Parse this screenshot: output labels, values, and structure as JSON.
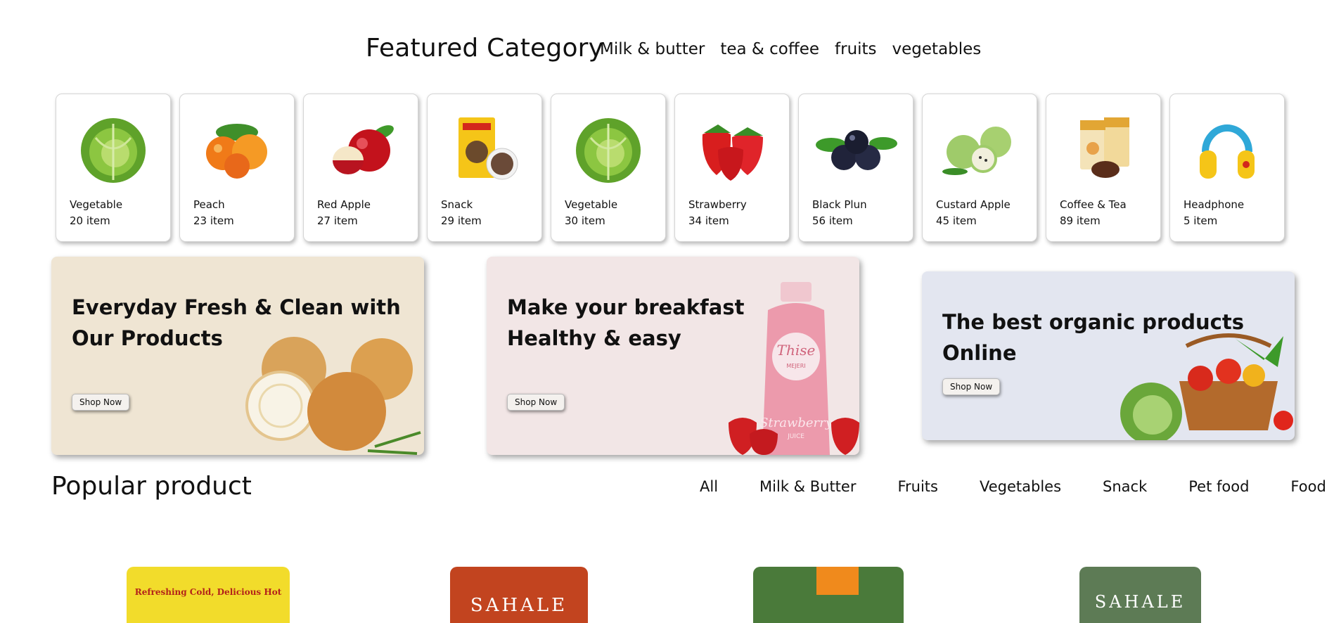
{
  "featured": {
    "title": "Featured Category",
    "tabs": [
      "Milk & butter",
      "tea & coffee",
      "fruits",
      "vegetables"
    ]
  },
  "categories": [
    {
      "name": "Vegetable",
      "count": "20 item",
      "icon": "cabbage-icon"
    },
    {
      "name": "Peach",
      "count": "23 item",
      "icon": "peach-icon"
    },
    {
      "name": "Red Apple",
      "count": "27 item",
      "icon": "apple-icon"
    },
    {
      "name": "Snack",
      "count": "29 item",
      "icon": "snack-pack-icon"
    },
    {
      "name": "Vegetable",
      "count": "30 item",
      "icon": "cabbage-icon"
    },
    {
      "name": "Strawberry",
      "count": "34 item",
      "icon": "strawberry-icon"
    },
    {
      "name": "Black Plun",
      "count": "56 item",
      "icon": "plum-icon"
    },
    {
      "name": "Custard Apple",
      "count": "45 item",
      "icon": "custard-apple-icon"
    },
    {
      "name": "Coffee & Tea",
      "count": "89 item",
      "icon": "coffee-pack-icon"
    },
    {
      "name": "Headphone",
      "count": "5 item",
      "icon": "headphone-icon"
    }
  ],
  "banners": [
    {
      "title": "Everyday Fresh & Clean with Our Products",
      "button": "Shop Now",
      "bg": "#efe5d3"
    },
    {
      "title": "Make your breakfast Healthy & easy",
      "button": "Shop Now",
      "bg": "#f2e6e6",
      "bottle_brand": "Thise",
      "bottle_sub": "MEJERI",
      "bottle_flavor": "Strawberry",
      "bottle_type": "JUICE"
    },
    {
      "title": "The best organic products Online",
      "button": "Shop Now",
      "bg": "#e3e6f0"
    }
  ],
  "popular": {
    "title": "Popular product",
    "tabs": [
      "All",
      "Milk & Butter",
      "Fruits",
      "Vegetables",
      "Snack",
      "Pet food",
      "Food"
    ]
  },
  "products": [
    {
      "label": "Refreshing Cold, Delicious Hot"
    },
    {
      "label": "SAHALE"
    },
    {
      "label": ""
    },
    {
      "label": "SAHALE"
    }
  ]
}
